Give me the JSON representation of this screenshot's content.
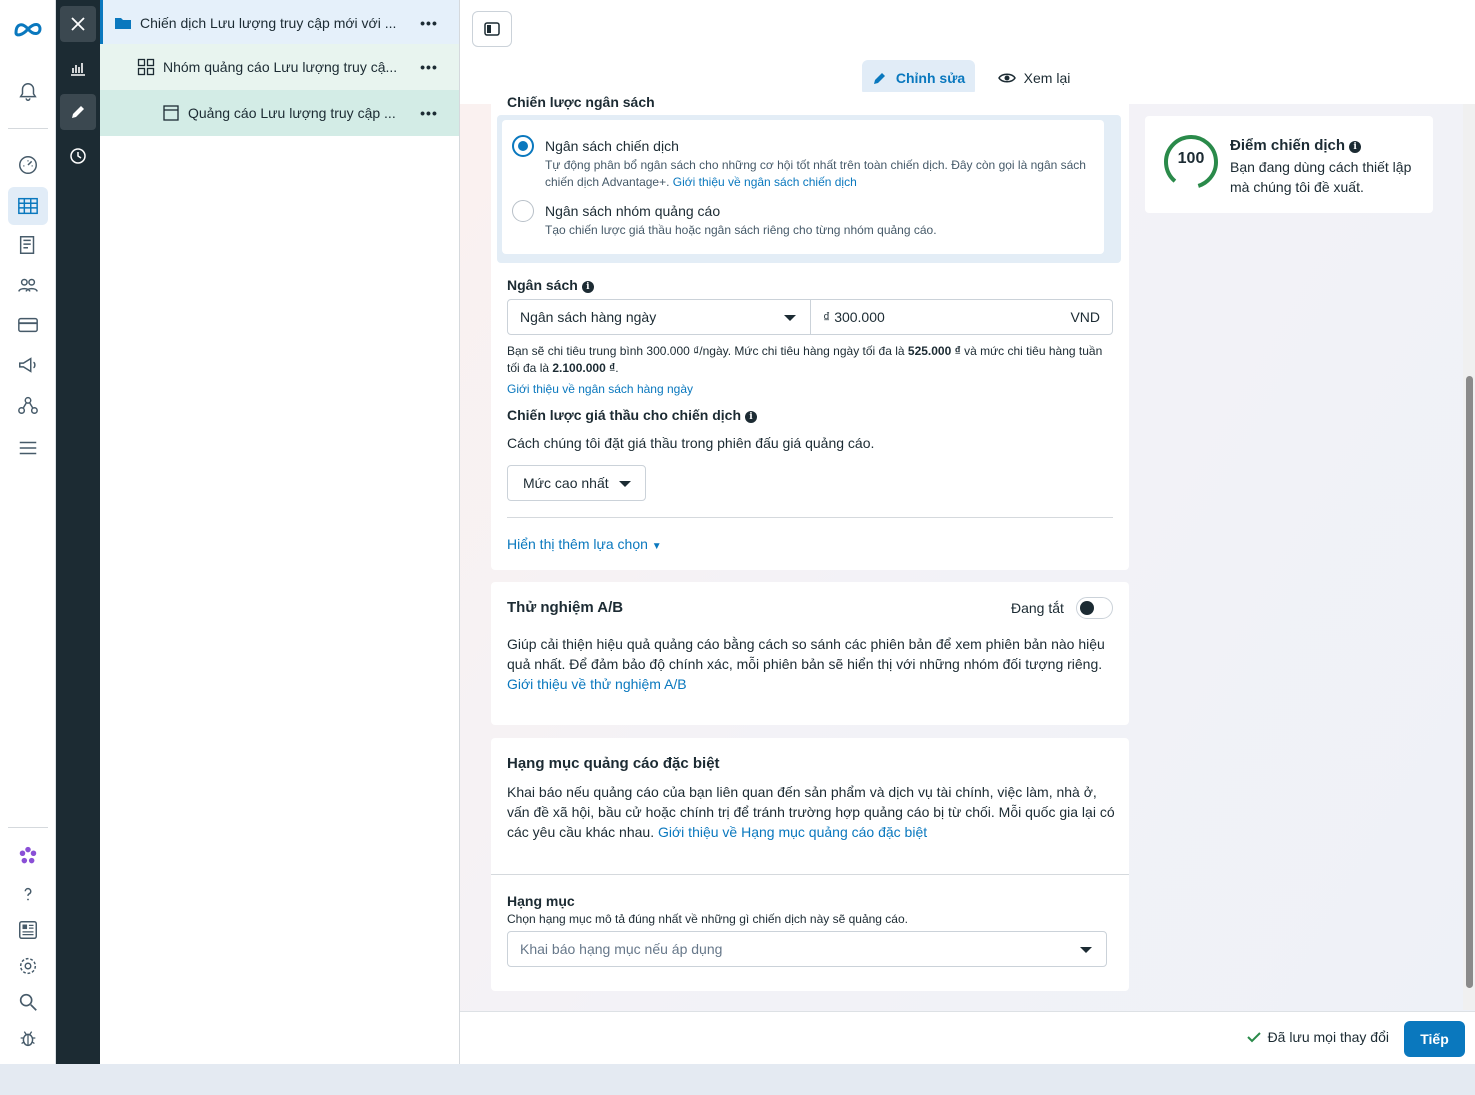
{
  "tree": {
    "campaign": "Chiến dịch Lưu lượng truy cập mới với ...",
    "adset": "Nhóm quảng cáo Lưu lượng truy cậ...",
    "ad": "Quảng cáo Lưu lượng truy cập ...",
    "more": "•••"
  },
  "tabs": {
    "edit": "Chỉnh sửa",
    "review": "Xem lại"
  },
  "budget_strategy": {
    "header": "Chiến lược ngân sách",
    "opt1_title": "Ngân sách chiến dịch",
    "opt1_desc_a": "Tự động phân bổ ngân sách cho những cơ hội tốt nhất trên toàn chiến dịch. Đây còn gọi là ngân sách chiến dịch Advantage+.",
    "opt1_link": "Giới thiệu về ngân sách chiến dịch",
    "opt2_title": "Ngân sách nhóm quảng cáo",
    "opt2_desc": "Tạo chiến lược giá thầu hoặc ngân sách riêng cho từng nhóm quảng cáo."
  },
  "budget": {
    "label": "Ngân sách",
    "type": "Ngân sách hàng ngày",
    "currency_symbol": "₫",
    "amount": "300.000",
    "currency": "VND",
    "note_a": "Bạn sẽ chi tiêu trung bình 300.000 ₫/ngày. Mức chi tiêu hàng ngày tối đa là",
    "note_max_day": "525.000 ₫",
    "note_b": "và mức chi tiêu hàng tuần tối đa là",
    "note_max_week": "2.100.000 ₫",
    "note_end": ".",
    "link": "Giới thiệu về ngân sách hàng ngày"
  },
  "bid": {
    "label": "Chiến lược giá thầu cho chiến dịch",
    "desc": "Cách chúng tôi đặt giá thầu trong phiên đấu giá quảng cáo.",
    "value": "Mức cao nhất",
    "more": "Hiển thị thêm lựa chọn"
  },
  "ab": {
    "title": "Thử nghiệm A/B",
    "status": "Đang tắt",
    "desc": "Giúp cải thiện hiệu quả quảng cáo bằng cách so sánh các phiên bản để xem phiên bản nào hiệu quả nhất. Để đảm bảo độ chính xác, mỗi phiên bản sẽ hiển thị với những nhóm đối tượng riêng.",
    "link": "Giới thiệu về thử nghiệm A/B"
  },
  "special": {
    "title": "Hạng mục quảng cáo đặc biệt",
    "desc": "Khai báo nếu quảng cáo của bạn liên quan đến sản phẩm và dịch vụ tài chính, việc làm, nhà ở, vấn đề xã hội, bầu cử hoặc chính trị để tránh trường hợp quảng cáo bị từ chối. Mỗi quốc gia lại có các yêu cầu khác nhau.",
    "link": "Giới thiệu về Hạng mục quảng cáo đặc biệt",
    "cat_label": "Hạng mục",
    "cat_desc": "Chọn hạng mục mô tả đúng nhất về những gì chiến dịch này sẽ quảng cáo.",
    "cat_placeholder": "Khai báo hạng mục nếu áp dụng"
  },
  "score": {
    "value": "100",
    "title": "Điểm chiến dịch",
    "desc": "Bạn đang dùng cách thiết lập mà chúng tôi đề xuất.",
    "color": "#2a8a4a"
  },
  "footer": {
    "saved": "Đã lưu mọi thay đổi",
    "next": "Tiếp"
  },
  "colors": {
    "accent": "#0a78be",
    "dark": "#1c2b33"
  }
}
